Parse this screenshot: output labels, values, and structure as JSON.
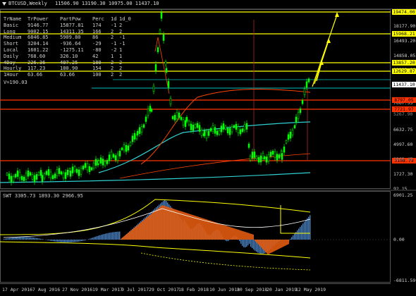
{
  "window": {
    "symbol_label": "BTCUSD,Weekly",
    "ohlc": "11506.90 13190.30 10975.00 11437.10"
  },
  "info_table": {
    "headers": [
      "TrName",
      "TrPower",
      "PartPow",
      "Perc",
      "1d",
      "1d_0"
    ],
    "rows": [
      [
        "Basic",
        "9146.77",
        "15877.81",
        "174",
        "-1",
        "2"
      ],
      [
        "Long",
        "9002.15",
        "14311.35",
        "166",
        "2",
        "2"
      ],
      [
        "Medium",
        "6846.85",
        "5909.80",
        "86",
        "2",
        "-1"
      ],
      [
        "Short",
        "3204.14",
        "-936.64",
        "-29",
        "-1",
        "-1"
      ],
      [
        "Local",
        "1601.22",
        "-1275.11",
        "-80",
        "-2",
        "1"
      ],
      [
        "Daily",
        "768.60",
        "326.10",
        "42",
        "1",
        "1"
      ],
      [
        "4Day",
        "226.36",
        "407.25",
        "180",
        "2",
        "2"
      ],
      [
        "Hourly",
        "117.23",
        "180.90",
        "154",
        "2",
        "2"
      ],
      [
        "1Hour",
        "63.66",
        "63.66",
        "100",
        "2",
        "2"
      ]
    ],
    "volume_text": "V=190.03"
  },
  "price_axis": {
    "ticks": [
      "19813.20",
      "18177.90",
      "16493.20",
      "14858.05",
      "13222.90",
      "11437.10",
      "7067.35",
      "6632.75",
      "4997.60",
      "3362.45",
      "1727.30",
      "92.15"
    ],
    "tags": [
      {
        "label": "19474.00",
        "bg": "#ffff00",
        "fg": "#000000"
      },
      {
        "label": "15968.21",
        "bg": "#ffff00",
        "fg": "#000000"
      },
      {
        "label": "13857.20",
        "bg": "#ffff00",
        "fg": "#000000"
      },
      {
        "label": "12629.87",
        "bg": "#ffff00",
        "fg": "#000000"
      },
      {
        "label": "11437.10",
        "bg": "#ffffff",
        "fg": "#000000"
      },
      {
        "label": "8797.05",
        "bg": "#ff3300",
        "fg": "#000000"
      },
      {
        "label": "7721.97",
        "bg": "#ff3300",
        "fg": "#000000"
      },
      {
        "label": "3108.79",
        "bg": "#ff3300",
        "fg": "#000000"
      }
    ],
    "faint_labels": [
      "5267.90",
      "3000.49"
    ]
  },
  "indicator": {
    "label": "SWT 3305.73 1893.30 2966.95",
    "ticks": [
      "6901.25",
      "0.00",
      "-6811.59"
    ]
  },
  "date_axis": {
    "labels": [
      "17 Apr 2016",
      "7 Aug 2016",
      "27 Nov 2016",
      "19 Mar 2017",
      "9 Jul 2017",
      "29 Oct 2017",
      "18 Feb 2018",
      "10 Jun 2018",
      "30 Sep 2018",
      "20 Jan 2019",
      "12 May 2019"
    ]
  },
  "colors": {
    "bull_candle": "#00ff00",
    "bear_candle": "#00ff00",
    "level_yellow": "#ffff00",
    "level_red": "#ff3300",
    "level_cyan": "#00bfbf",
    "ma_cyan": "#2fd0d0",
    "hist_blue": "#4a86c8",
    "hist_orange": "#e05a10"
  }
}
